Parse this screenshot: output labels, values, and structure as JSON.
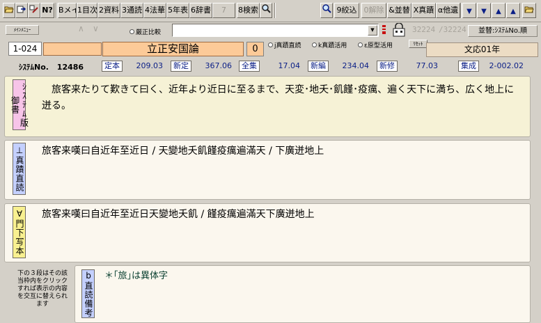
{
  "toolbar": {
    "b_open_icon": "folder-open",
    "b_export_icon": "export-arrow",
    "b_wizard_icon": "wizard",
    "b_help": "N?",
    "b_main": "Bメイン",
    "b_toc": "1目次",
    "b_material": "2資料",
    "b_tsuken": "3通読",
    "b_hokke": "4法華",
    "b_nenpyo": "5年表",
    "b_jisho": "6辞書",
    "b_disabled_hyphen": "7",
    "b_search": "8検索",
    "b_searchmag_icon": "magnifier",
    "b_search2_icon": "magnifier-plus",
    "b_narrow": "9絞込",
    "b_clear": "0解除",
    "b_sort": "&並替",
    "b_shinseki": "X真蹟",
    "b_other": "α他遺",
    "b_last_icon": "double-down",
    "b_down_icon": "down",
    "b_up_icon": "up",
    "b_first_icon": "double-up",
    "b_folder_icon": "folder-open"
  },
  "row2": {
    "main_menu": "ﾒｲﾝﾒﾆｭｰ",
    "prev": "∧",
    "next": "∨",
    "compare_radio": "厳正比較",
    "counter_current": "32224",
    "counter_total": "/32224",
    "sort_label": "並替:ｼｽﾃﾑNo.順"
  },
  "header": {
    "id": "1-024",
    "title": "立正安国論",
    "count": "0",
    "radio_1": "j真蹟直読",
    "radio_2": "k真蹟活用",
    "radio_3": "ε原型活用",
    "reset": "ﾘｾｯﾄ",
    "era": "文応01年"
  },
  "meta": {
    "sysno_label": "ｼｽﾃﾑNo.",
    "sysno_value": "12486",
    "fields": [
      {
        "label": "定本",
        "value": "209.03"
      },
      {
        "label": "新定",
        "value": "367.06"
      },
      {
        "label": "全集",
        "value": "17.04"
      },
      {
        "label": "新編",
        "value": "234.04"
      },
      {
        "label": "新修",
        "value": "77.03"
      },
      {
        "label": "集成",
        "value": "2-002.02"
      }
    ]
  },
  "panels": {
    "p1_tag": "ｼｽﾃﾑ版御書",
    "p1_text": "　旅客来たりて歎きて曰く、近年より近日に至るまで、天変･地夭･飢饉･疫癘、遍く天下に満ち、広く地上に迸る。",
    "p2_tag": "⊥真蹟直読",
    "p2_text": "旅客来嘆曰自近年至近日 / 天變地夭飢饉疫癘遍滿天 / 下廣迸地上",
    "p3_tag": "∀門下写本",
    "p3_text": "旅客来嘆曰自近年至近日天變地夭飢 / 饉疫癘遍滿天下廣迸地上",
    "p4_tag": "b直読備考",
    "p4_text": "＊｢旅｣は異体字",
    "side_note": "下の３段はその該当枠内をクリックすれば表示の内容を交互に替えられます"
  },
  "colors": {
    "accent_blue": "#0a1e86",
    "panel_yellow": "#f6f2d6",
    "panel_cream": "#fbf7ee",
    "title_orange": "#fcca98",
    "tag_pink": "#f7c4e8",
    "tag_blue": "#c4d0ff",
    "tag_yellow": "#f8f090"
  }
}
